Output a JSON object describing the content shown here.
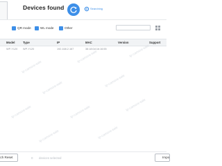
{
  "header": {
    "title": "Devices found",
    "status_text": "Searching"
  },
  "filters": {
    "items": [
      {
        "label": "QR mode"
      },
      {
        "label": "WL mode"
      },
      {
        "label": "Other"
      }
    ],
    "search_placeholder": ""
  },
  "table": {
    "columns": [
      "Model",
      "Type",
      "IP",
      "MAC",
      "Version",
      "Support"
    ],
    "rows": [
      {
        "model": "WP-Y120",
        "type": "WP-Y120",
        "ip": "192.168.2.167",
        "mac": "38:18:0d:1b:16:55",
        "version": "",
        "support": ""
      }
    ]
  },
  "watermark": "Ip-camera-sale",
  "footer": {
    "reset_label": "Batch Reset",
    "selected_count": "0",
    "selected_text": "devices selected",
    "right_button_label": "Import"
  },
  "colors": {
    "accent": "#3d8fe8"
  }
}
